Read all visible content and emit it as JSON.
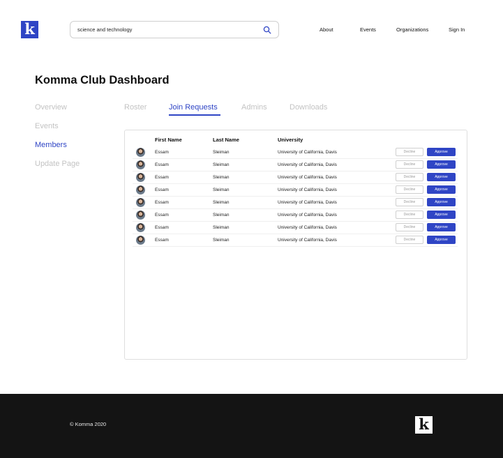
{
  "header": {
    "logo_letter": "k",
    "search": {
      "value": "science and technology",
      "icon": "search-icon"
    },
    "nav": {
      "about": "About",
      "events": "Events",
      "organizations": "Organizations",
      "sign_in": "Sign In"
    },
    "brand_color": "#2f45c5"
  },
  "page": {
    "title": "Komma Club Dashboard"
  },
  "sidebar": {
    "items": [
      {
        "label": "Overview",
        "active": false
      },
      {
        "label": "Events",
        "active": false
      },
      {
        "label": "Members",
        "active": true
      },
      {
        "label": "Update Page",
        "active": false
      }
    ]
  },
  "tabs": [
    {
      "label": "Roster",
      "active": false
    },
    {
      "label": "Join Requests",
      "active": true
    },
    {
      "label": "Admins",
      "active": false
    },
    {
      "label": "Downloads",
      "active": false
    }
  ],
  "table": {
    "headers": {
      "first_name": "First Name",
      "last_name": "Last Name",
      "university": "University"
    },
    "decline_label": "Decline",
    "approve_label": "Approve",
    "rows": [
      {
        "first": "Essam",
        "last": "Sleiman",
        "university": "University of California, Davis"
      },
      {
        "first": "Essam",
        "last": "Sleiman",
        "university": "University of California, Davis"
      },
      {
        "first": "Essam",
        "last": "Sleiman",
        "university": "University of California, Davis"
      },
      {
        "first": "Essam",
        "last": "Sleiman",
        "university": "University of California, Davis"
      },
      {
        "first": "Essam",
        "last": "Sleiman",
        "university": "University of California, Davis"
      },
      {
        "first": "Essam",
        "last": "Sleiman",
        "university": "University of California, Davis"
      },
      {
        "first": "Essam",
        "last": "Sleiman",
        "university": "University of California, Davis"
      },
      {
        "first": "Essam",
        "last": "Sleiman",
        "university": "University of California, Davis"
      }
    ]
  },
  "footer": {
    "copyright": "© Komma 2020",
    "logo_letter": "k"
  }
}
